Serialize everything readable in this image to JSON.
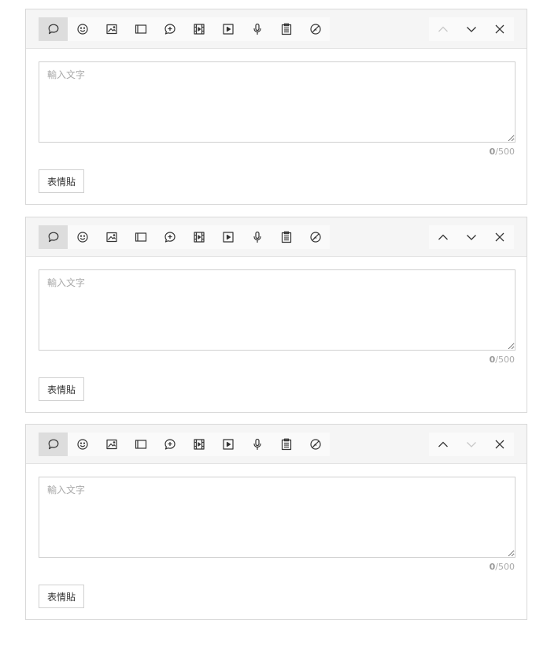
{
  "panels": [
    {
      "textarea_placeholder": "輸入文字",
      "textarea_value": "",
      "count_current": "0",
      "count_max": "/500",
      "sticker_label": "表情貼",
      "up_disabled": true,
      "down_disabled": false
    },
    {
      "textarea_placeholder": "輸入文字",
      "textarea_value": "",
      "count_current": "0",
      "count_max": "/500",
      "sticker_label": "表情貼",
      "up_disabled": false,
      "down_disabled": false
    },
    {
      "textarea_placeholder": "輸入文字",
      "textarea_value": "",
      "count_current": "0",
      "count_max": "/500",
      "sticker_label": "表情貼",
      "up_disabled": false,
      "down_disabled": true
    }
  ],
  "toolbar_icons": [
    "text-message-icon",
    "sticker-icon",
    "image-icon",
    "card-icon",
    "add-bubble-icon",
    "video-icon",
    "play-icon",
    "microphone-icon",
    "clipboard-icon",
    "no-image-icon"
  ],
  "nav_icons": [
    "chevron-up-icon",
    "chevron-down-icon",
    "close-icon"
  ],
  "colors": {
    "toolbar_bg": "#f5f5f5",
    "active_tool_bg": "#dddddd",
    "border": "#d9d9d9",
    "placeholder": "#aaaaaa",
    "disabled_icon": "#c8c8c8"
  }
}
